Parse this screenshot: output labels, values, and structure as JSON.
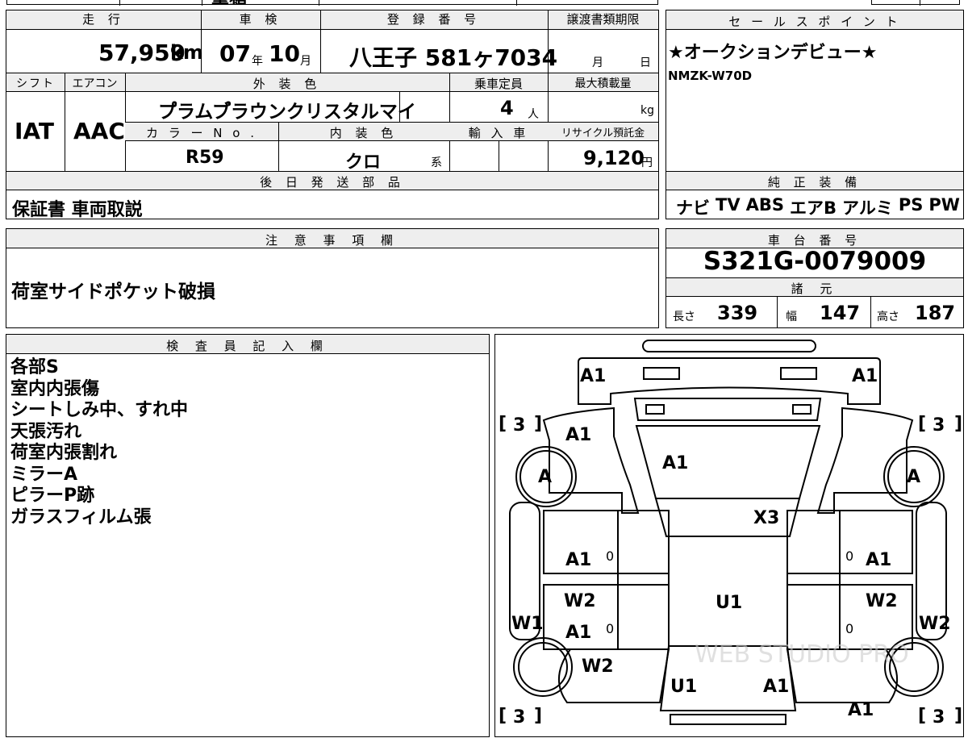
{
  "top_fragment": "書類",
  "labels": {
    "mileage": "走 行",
    "inspection": "車 検",
    "registration": "登 録 番 号",
    "doc_deadline": "譲渡書類期限",
    "sales_point": "セ ー ル ス ポ イ ン ト",
    "shift": "シフト",
    "aircon": "エアコン",
    "ext_color": "外 装 色",
    "capacity": "乗車定員",
    "max_load": "最大積載量",
    "color_no": "カ ラ ー N o .",
    "int_color": "内 装 色",
    "import": "輸 入 車",
    "recycle": "リサイクル預託金",
    "later_parts": "後 日 発 送 部 品",
    "genuine_equipment": "純 正 装 備",
    "notes": "注 意 事 項 欄",
    "chassis_no": "車 台 番 号",
    "specs": "諸 元",
    "inspector": "検 査 員 記 入 欄"
  },
  "vehicle": {
    "mileage": "57,959",
    "mileage_unit": "km",
    "inspection_year": "07",
    "year_unit": "年",
    "inspection_month": "10",
    "month_unit": "月",
    "plate": "八王子 581ヶ7034",
    "deadline_month": "月",
    "deadline_day": "日",
    "shift": "IAT",
    "aircon": "AAC",
    "ext_color": "プ゚ラムブ゚ラウンクリスタルマイ",
    "capacity": "4",
    "capacity_unit": "人",
    "max_load_unit": "kg",
    "color_no": "R59",
    "int_color": "クロ",
    "int_color_suffix": "系",
    "recycle_fee": "9,120",
    "recycle_unit": "円",
    "later_parts": "保証書 車両取説",
    "chassis_no": "S321G-0079009"
  },
  "sales_points": [
    "★オークションデビュー★",
    "NMZK-W70D"
  ],
  "equipment": [
    "ナビ",
    "TV",
    "ABS",
    "エアB",
    "アルミ",
    "PS",
    "PW"
  ],
  "notes": "荷室サイドポケット破損",
  "specs": {
    "length_label": "長さ",
    "length": "339",
    "width_label": "幅",
    "width": "147",
    "height_label": "高さ",
    "height": "187"
  },
  "inspector_notes": [
    "各部S",
    "室内内張傷",
    "シートしみ中、すれ中",
    "天張汚れ",
    "荷室内張割れ",
    "ミラーA",
    "ピラーP跡",
    "ガラスフィルム張"
  ],
  "diagram_marks": {
    "rear_left": "A1",
    "rear_right": "A1",
    "tire_rl": "3",
    "tire_rr": "3",
    "tire_fl": "3",
    "tire_fr": "3",
    "rear_quarter_l": "A1",
    "rear_glass": "A1",
    "mirror_l": "A",
    "mirror_r": "A",
    "roof": "X3",
    "rear_door_l": "A1",
    "rear_door_l_zero": "0",
    "rear_door_r": "A1",
    "rear_door_r_zero": "0",
    "front_door_l_w": "W2",
    "front_door_l_a": "A1",
    "front_door_l_zero": "0",
    "front_door_r_w": "W2",
    "front_door_r_zero": "0",
    "center": "U1",
    "sill_l": "W1",
    "sill_r": "W2",
    "fender_l": "W2",
    "hood_u": "U1",
    "hood_a": "A1",
    "front_r": "A1"
  }
}
